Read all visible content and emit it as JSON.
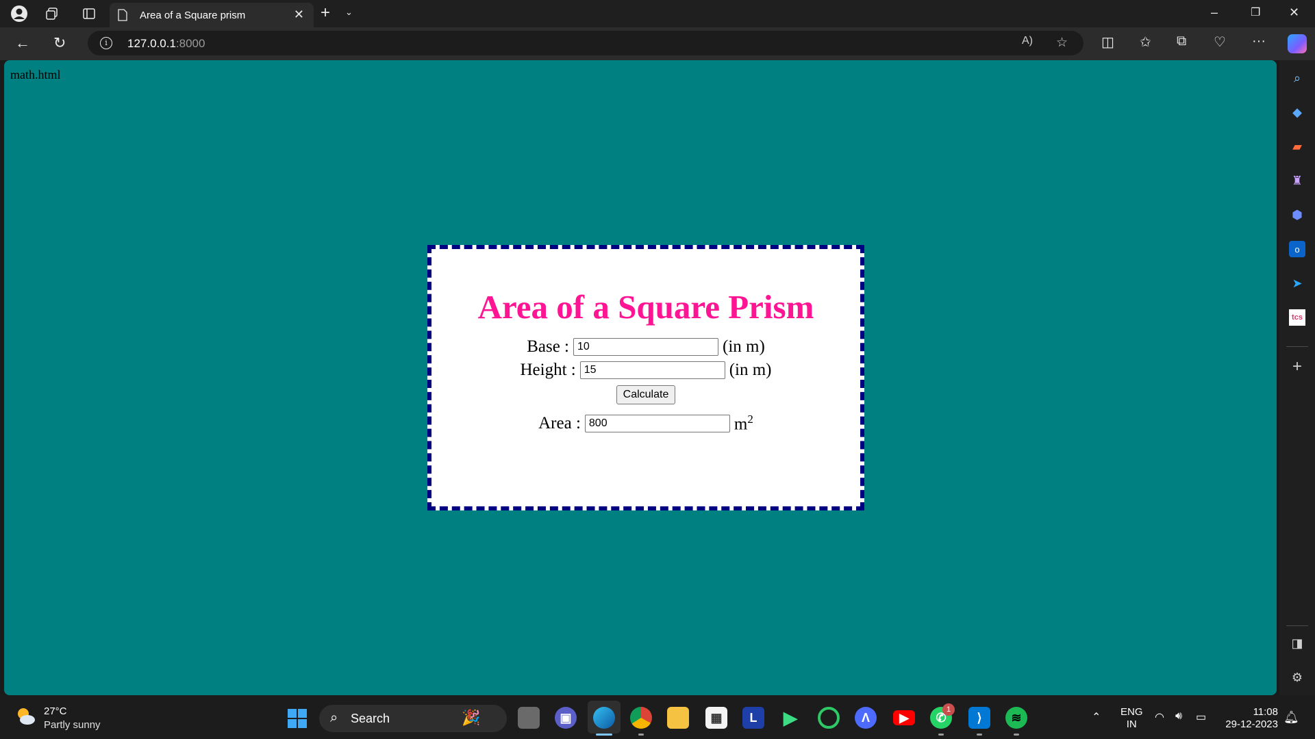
{
  "browser": {
    "tab_title": "Area of a Square prism",
    "url_host": "127.0.0.1",
    "url_port": ":8000"
  },
  "page": {
    "breadcrumb": "math.html",
    "heading": "Area of a Square Prism",
    "base_label": "Base :",
    "base_value": "10",
    "base_unit": "(in m)",
    "height_label": "Height :",
    "height_value": "15",
    "height_unit": "(in m)",
    "calculate_label": "Calculate",
    "area_label": "Area :",
    "area_value": "800",
    "area_unit_base": "m",
    "area_unit_exp": "2"
  },
  "taskbar": {
    "weather_temp": "27°C",
    "weather_desc": "Partly sunny",
    "search_label": "Search",
    "whatsapp_badge": "1",
    "lang_line1": "ENG",
    "lang_line2": "IN",
    "time": "11:08",
    "date": "29-12-2023"
  },
  "colors": {
    "page_bg": "#008080",
    "card_border": "#000080",
    "heading": "#ff1493",
    "titlebar": "#1f1f1f",
    "taskbar": "#1c1c1c"
  },
  "icons": [
    "profile-icon",
    "workspaces-icon",
    "vertical-tabs-icon",
    "document-icon",
    "close-icon",
    "new-tab-icon",
    "back-icon",
    "refresh-icon",
    "info-icon",
    "read-aloud-icon",
    "favorite-star-icon",
    "split-screen-icon",
    "favorites-icon",
    "collections-icon",
    "browser-essentials-icon",
    "more-icon",
    "copilot-icon",
    "search-icon",
    "shopping-icon",
    "tools-icon",
    "games-icon",
    "office-icon",
    "outlook-icon",
    "telegram-icon",
    "tcs-icon",
    "add-icon",
    "sidebar-toggle-icon",
    "settings-icon",
    "windows-start-icon",
    "wifi-icon",
    "volume-icon",
    "battery-icon",
    "bell-icon"
  ]
}
